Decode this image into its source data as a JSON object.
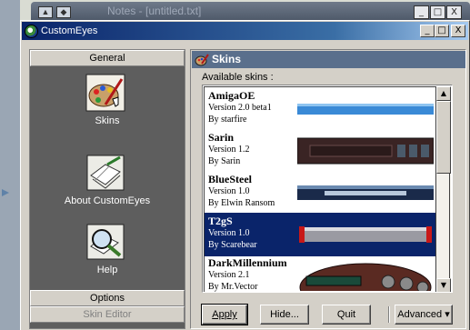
{
  "background_app": {
    "title": "Notes - [untitled.txt]"
  },
  "window": {
    "title": "CustomEyes"
  },
  "title_buttons": {
    "minimize": "_",
    "maximize": "□",
    "close": "X"
  },
  "sidebar": {
    "header": "General",
    "items": [
      {
        "label": "Skins",
        "icon": "skins-palette-icon"
      },
      {
        "label": "About CustomEyes",
        "icon": "about-page-icon"
      },
      {
        "label": "Help",
        "icon": "help-magnifier-icon"
      }
    ],
    "footer": [
      {
        "label": "Options"
      },
      {
        "label": "Skin Editor"
      }
    ]
  },
  "panel": {
    "title": "Skins",
    "available_label": "Available skins :",
    "skins": [
      {
        "name": "AmigaOE",
        "version": "Version 2.0 beta1",
        "author": "By starfire"
      },
      {
        "name": "Sarin",
        "version": "Version 1.2",
        "author": "By Sarin"
      },
      {
        "name": "BlueSteel",
        "version": "Version 1.0",
        "author": "By Elwin Ransom"
      },
      {
        "name": "T2gS",
        "version": "Version 1.0",
        "author": "By Scarebear"
      },
      {
        "name": "DarkMillennium",
        "version": "Version 2.1",
        "author": "By Mr.Vector"
      }
    ],
    "selected_index": 3
  },
  "buttons": {
    "apply": "Apply",
    "hide": "Hide...",
    "quit": "Quit",
    "advanced": "Advanced"
  },
  "colors": {
    "selection": "#0a246a",
    "sidebar_bg": "#5e5e5e",
    "panel_header": "#5a6f8c"
  }
}
